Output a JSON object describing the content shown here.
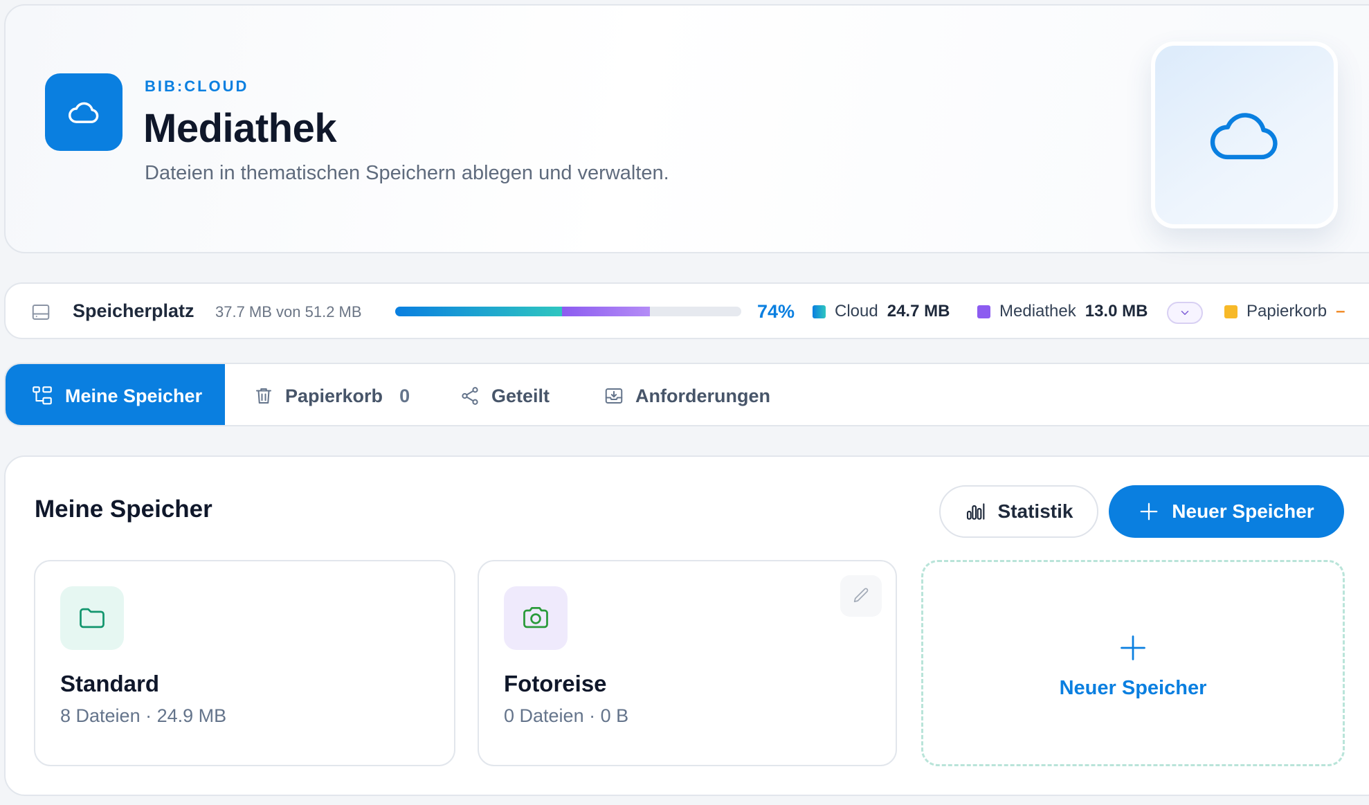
{
  "header": {
    "brand": "BIB:CLOUD",
    "title": "Mediathek",
    "subtitle": "Dateien in thematischen Speichern ablegen und verwalten.",
    "logo_icon": "cloud-icon",
    "illustration_icon": "cloud-icon"
  },
  "storage": {
    "label": "Speicherplatz",
    "used_text": "37.7 MB von 51.2 MB",
    "percent_text": "74%",
    "percent_value": 0.74,
    "segments": {
      "cloud_fraction": 0.482,
      "mediathek_fraction": 0.254
    },
    "legend": [
      {
        "name": "Cloud",
        "value": "24.7 MB",
        "color": "#0a7fe0"
      },
      {
        "name": "Mediathek",
        "value": "13.0 MB",
        "color": "#8c5cf0"
      },
      {
        "name": "Papierkorb",
        "value": "–",
        "color": "#f7b928"
      }
    ],
    "expand_icon": "chevron-down-icon"
  },
  "tabs": [
    {
      "label": "Meine Speicher",
      "icon": "tree-icon",
      "active": true
    },
    {
      "label": "Papierkorb",
      "icon": "trash-icon",
      "count": "0"
    },
    {
      "label": "Geteilt",
      "icon": "share-icon"
    },
    {
      "label": "Anforderungen",
      "icon": "inbox-download-icon"
    }
  ],
  "panel": {
    "title": "Meine Speicher",
    "stats_button": "Statistik",
    "new_button": "Neuer Speicher",
    "cards": [
      {
        "name": "Standard",
        "meta": "8 Dateien · 24.9 MB",
        "icon": "folder-icon",
        "icon_bg": "#e6f7f2",
        "icon_color": "#12966e"
      },
      {
        "name": "Fotoreise",
        "meta": "0 Dateien · 0 B",
        "icon": "camera-icon",
        "icon_bg": "#efeafc",
        "icon_color": "#2a9b3a"
      }
    ],
    "add_card_label": "Neuer Speicher"
  },
  "colors": {
    "accent": "#0a7fe0",
    "mediathek": "#8c5cf0",
    "papierkorb": "#f7b928"
  }
}
